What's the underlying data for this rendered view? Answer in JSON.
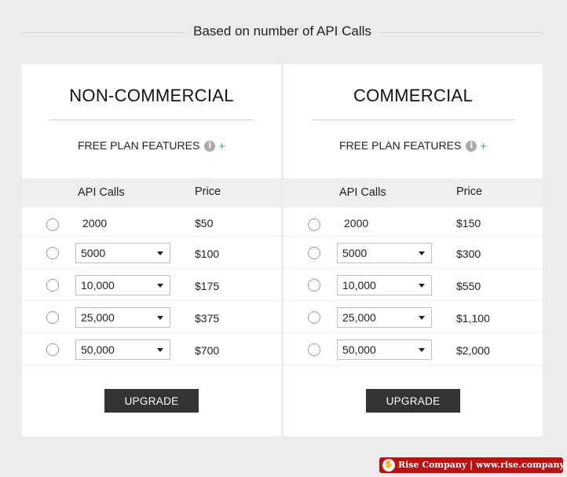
{
  "header": {
    "title": "Based on number of API Calls"
  },
  "plans": [
    {
      "title": "NON-COMMERCIAL",
      "features_label": "FREE PLAN FEATURES",
      "col_api": "API Calls",
      "col_price": "Price",
      "rows": [
        {
          "calls": "2000",
          "price": "$50"
        },
        {
          "calls": "5000",
          "price": "$100"
        },
        {
          "calls": "10,000",
          "price": "$175"
        },
        {
          "calls": "25,000",
          "price": "$375"
        },
        {
          "calls": "50,000",
          "price": "$700"
        }
      ],
      "button": "UPGRADE"
    },
    {
      "title": "COMMERCIAL",
      "features_label": "FREE PLAN FEATURES",
      "col_api": "API Calls",
      "col_price": "Price",
      "rows": [
        {
          "calls": "2000",
          "price": "$150"
        },
        {
          "calls": "5000",
          "price": "$300"
        },
        {
          "calls": "10,000",
          "price": "$550"
        },
        {
          "calls": "25,000",
          "price": "$1,100"
        },
        {
          "calls": "50,000",
          "price": "$2,000"
        }
      ],
      "button": "UPGRADE"
    }
  ],
  "icons": {
    "info": "info-icon",
    "plus": "plus-icon",
    "caret": "caret-down-icon"
  },
  "colors": {
    "accent_plus": "#3cb371",
    "button_bg": "#333333",
    "watermark_bg": "#bb1111"
  },
  "watermark": {
    "text": "Rise Company | www.rise.company"
  }
}
